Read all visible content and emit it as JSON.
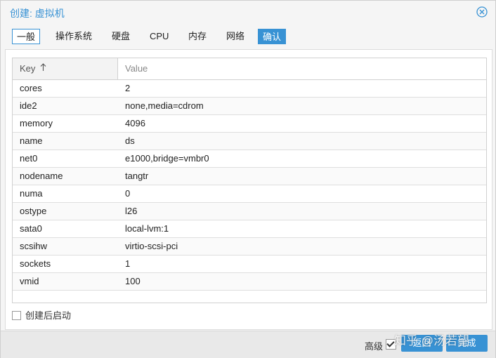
{
  "dialog": {
    "title": "创建: 虚拟机",
    "close_icon": "close-circle-icon"
  },
  "tabs": [
    {
      "label": "一般"
    },
    {
      "label": "操作系统"
    },
    {
      "label": "硬盘"
    },
    {
      "label": "CPU"
    },
    {
      "label": "内存"
    },
    {
      "label": "网络"
    },
    {
      "label": "确认"
    }
  ],
  "grid": {
    "columns": {
      "key": "Key",
      "value": "Value"
    },
    "sort_icon": "arrow-up-icon",
    "rows": [
      {
        "key": "cores",
        "value": "2"
      },
      {
        "key": "ide2",
        "value": "none,media=cdrom"
      },
      {
        "key": "memory",
        "value": "4096"
      },
      {
        "key": "name",
        "value": "ds"
      },
      {
        "key": "net0",
        "value": "e1000,bridge=vmbr0"
      },
      {
        "key": "nodename",
        "value": "tangtr"
      },
      {
        "key": "numa",
        "value": "0"
      },
      {
        "key": "ostype",
        "value": "l26"
      },
      {
        "key": "sata0",
        "value": "local-lvm:1"
      },
      {
        "key": "scsihw",
        "value": "virtio-scsi-pci"
      },
      {
        "key": "sockets",
        "value": "1"
      },
      {
        "key": "vmid",
        "value": "100"
      }
    ]
  },
  "start_after_create": {
    "label": "创建后启动",
    "checked": false
  },
  "footer": {
    "advanced_label": "高级",
    "advanced_checked": true,
    "back_label": "返回",
    "finish_label": "完成"
  },
  "watermark": "知乎 @汤若望",
  "colors": {
    "accent": "#3892d4"
  }
}
